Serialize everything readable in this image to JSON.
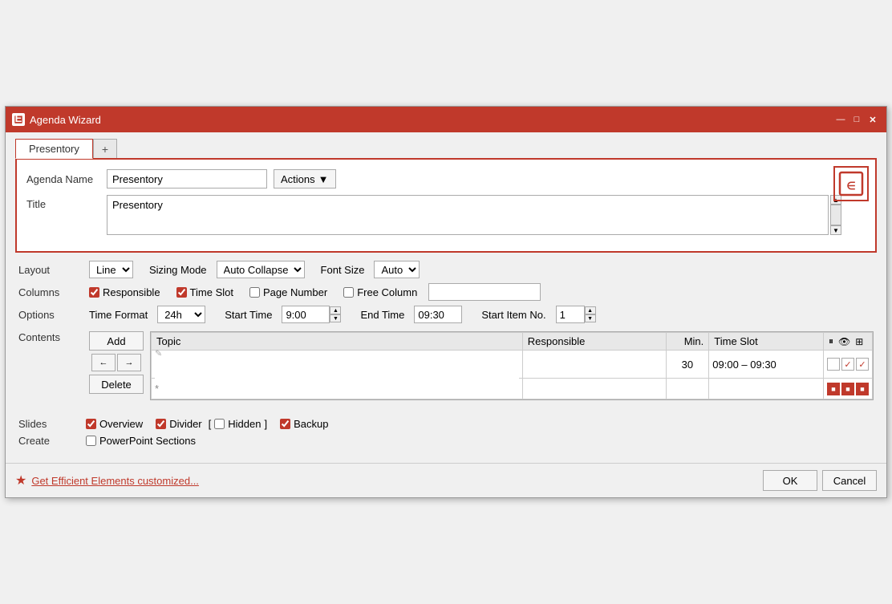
{
  "window": {
    "title": "Agenda Wizard",
    "logo_alt": "E"
  },
  "tabs": {
    "active": "Presentory",
    "items": [
      "Presentory"
    ],
    "add_label": "+"
  },
  "agenda": {
    "name_label": "Agenda Name",
    "name_value": "Presentory",
    "actions_label": "Actions",
    "title_label": "Title",
    "title_value": "Presentory"
  },
  "layout": {
    "layout_label": "Layout",
    "layout_value": "Line",
    "sizing_label": "Sizing Mode",
    "sizing_value": "Auto Collapse",
    "font_label": "Font Size",
    "font_value": "Auto",
    "columns_label": "Columns",
    "responsible_label": "Responsible",
    "responsible_checked": true,
    "timeslot_label": "Time Slot",
    "timeslot_checked": true,
    "pagenumber_label": "Page Number",
    "pagenumber_checked": false,
    "freecolumn_label": "Free Column",
    "freecolumn_checked": false,
    "freecolumn_value": "",
    "options_label": "Options",
    "timeformat_label": "Time Format",
    "timeformat_value": "24h",
    "starttime_label": "Start Time",
    "starttime_value": "9:00",
    "endtime_label": "End Time",
    "endtime_value": "09:30",
    "startitem_label": "Start Item No.",
    "startitem_value": "1"
  },
  "contents": {
    "label": "Contents",
    "add_btn": "Add",
    "delete_btn": "Delete",
    "columns": [
      "Topic",
      "Responsible",
      "Min.",
      "Time Slot",
      ""
    ],
    "row1": {
      "topic": "",
      "responsible": "",
      "min": "30",
      "timeslot": "09:00 – 09:30",
      "edit_icon": "✎"
    },
    "row2": {
      "topic": "",
      "responsible": "",
      "min": "",
      "timeslot": "",
      "is_new": true
    }
  },
  "slides": {
    "label": "Slides",
    "overview_label": "Overview",
    "overview_checked": true,
    "divider_label": "Divider",
    "divider_checked": true,
    "hidden_label": "Hidden",
    "hidden_prefix": "[ ",
    "hidden_suffix": " ]",
    "hidden_checked": false,
    "backup_label": "Backup",
    "backup_checked": true
  },
  "create": {
    "label": "Create",
    "ppt_sections_label": "PowerPoint Sections",
    "ppt_sections_checked": false
  },
  "footer": {
    "star": "★",
    "link_text": "Get Efficient Elements customized...",
    "ok_label": "OK",
    "cancel_label": "Cancel"
  }
}
